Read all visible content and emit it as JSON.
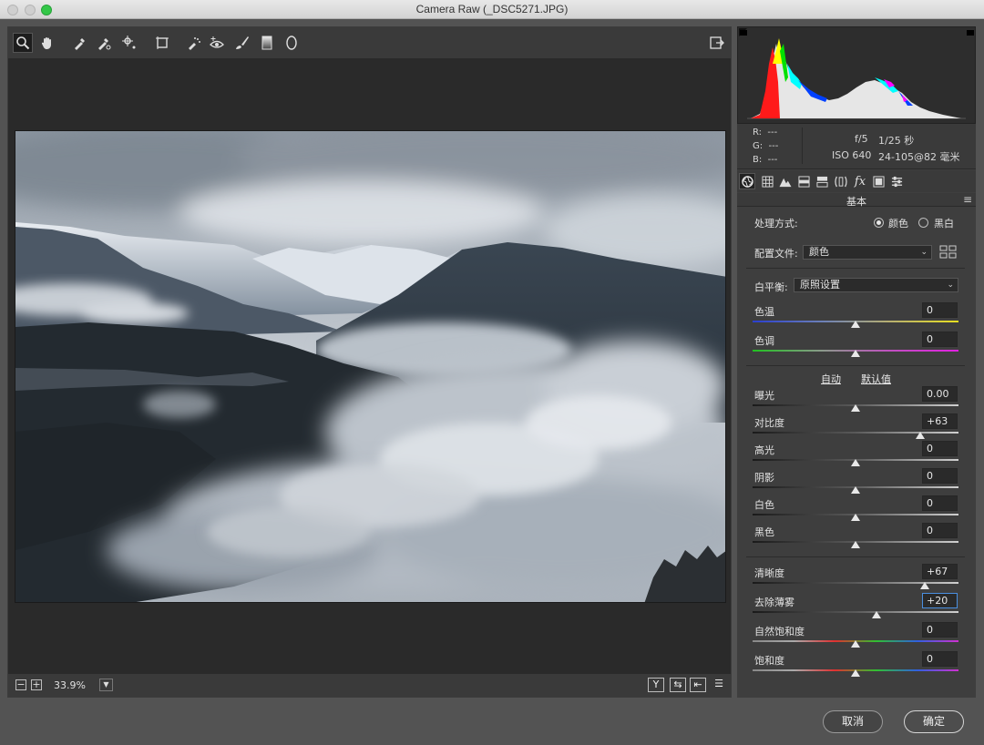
{
  "window": {
    "title": "Camera Raw (_DSC5271.JPG)"
  },
  "toolbar": {
    "tools": [
      "zoom-tool",
      "hand-tool",
      "white-balance-tool",
      "color-sampler-tool",
      "target-adjust-tool",
      "transform-tool",
      "spot-removal-tool",
      "red-eye-tool",
      "adjustment-brush-tool",
      "graduated-filter-tool",
      "radial-filter-tool"
    ],
    "selected": "zoom-tool",
    "right_tool": "open-preferences-icon"
  },
  "preview": {
    "zoom_value": "33.9%",
    "zoom_out_label": "−",
    "zoom_in_label": "+",
    "right_buttons": [
      "Y",
      "⇆",
      "⇤",
      "☰"
    ]
  },
  "readout": {
    "r_label": "R:",
    "r_value": "---",
    "g_label": "G:",
    "g_value": "---",
    "b_label": "B:",
    "b_value": "---",
    "aperture": "f/5",
    "shutter": "1/25 秒",
    "iso": "ISO 640",
    "lens": "24-105@82 毫米"
  },
  "panel": {
    "title": "基本",
    "menu_icon": "≡",
    "process_label": "处理方式:",
    "process_color": "颜色",
    "process_bw": "黑白",
    "process_selected": "颜色",
    "profile_label": "配置文件:",
    "profile_value": "颜色",
    "wb_label": "白平衡:",
    "wb_value": "原照设置",
    "auto_label": "自动",
    "default_label": "默认值"
  },
  "sliders": [
    {
      "id": "temp",
      "label": "色温",
      "value": "0",
      "pos": 0.5,
      "gradient": "temp"
    },
    {
      "id": "tint",
      "label": "色调",
      "value": "0",
      "pos": 0.5,
      "gradient": "tint"
    },
    {
      "id": "exposure",
      "label": "曝光",
      "value": "0.00",
      "pos": 0.5,
      "gradient": "gray"
    },
    {
      "id": "contrast",
      "label": "对比度",
      "value": "+63",
      "pos": 0.815,
      "gradient": "gray"
    },
    {
      "id": "highlights",
      "label": "高光",
      "value": "0",
      "pos": 0.5,
      "gradient": "gray"
    },
    {
      "id": "shadows",
      "label": "阴影",
      "value": "0",
      "pos": 0.5,
      "gradient": "gray"
    },
    {
      "id": "whites",
      "label": "白色",
      "value": "0",
      "pos": 0.5,
      "gradient": "gray"
    },
    {
      "id": "blacks",
      "label": "黑色",
      "value": "0",
      "pos": 0.5,
      "gradient": "gray"
    },
    {
      "id": "clarity",
      "label": "清晰度",
      "value": "+67",
      "pos": 0.835,
      "gradient": "gray"
    },
    {
      "id": "dehaze",
      "label": "去除薄雾",
      "value": "+20",
      "pos": 0.6,
      "gradient": "gray",
      "active": true
    },
    {
      "id": "vibrance",
      "label": "自然饱和度",
      "value": "0",
      "pos": 0.5,
      "gradient": "sat"
    },
    {
      "id": "saturation",
      "label": "饱和度",
      "value": "0",
      "pos": 0.5,
      "gradient": "sat"
    }
  ],
  "footer": {
    "cancel_label": "取消",
    "ok_label": "确定"
  },
  "colors": {
    "accent": "#4a8fe0",
    "panel_bg": "#3e3e3e",
    "close_light": "#33c748"
  }
}
